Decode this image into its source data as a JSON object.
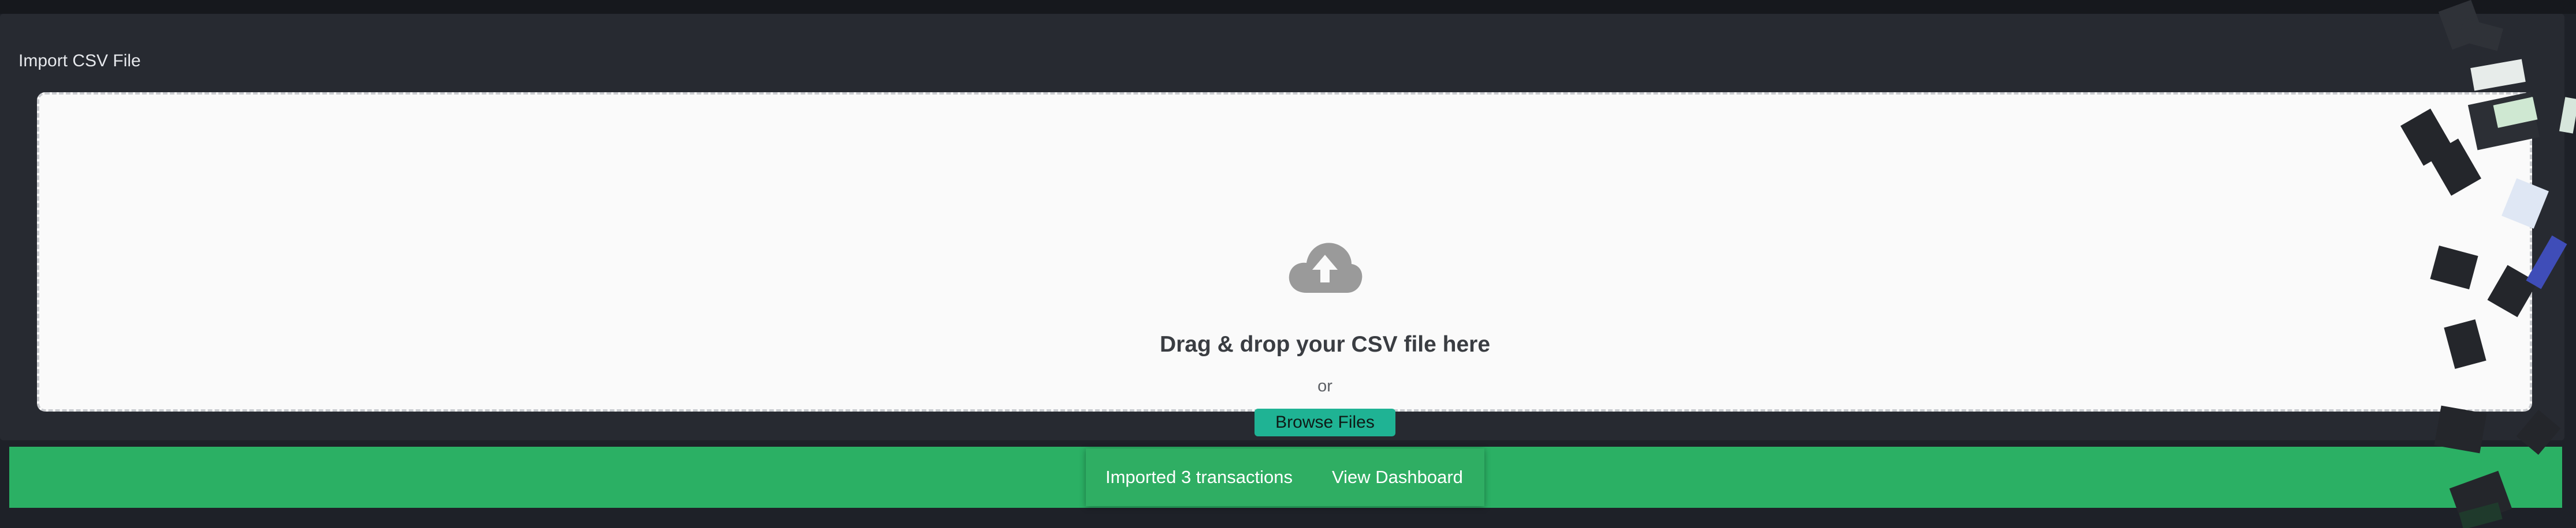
{
  "panel": {
    "title": "Import CSV File"
  },
  "dropzone": {
    "icon": "cloud-upload-icon",
    "heading": "Drag & drop your CSV file here",
    "or_text": "or",
    "browse_label": "Browse Files"
  },
  "notification": {
    "message": "Imported 3 transactions",
    "action_label": "View Dashboard"
  },
  "colors": {
    "background": "#1e2128",
    "panel": "#272a31",
    "dropzone": "#fafafa",
    "accent": "#1fb394",
    "success": "#2bb064"
  }
}
